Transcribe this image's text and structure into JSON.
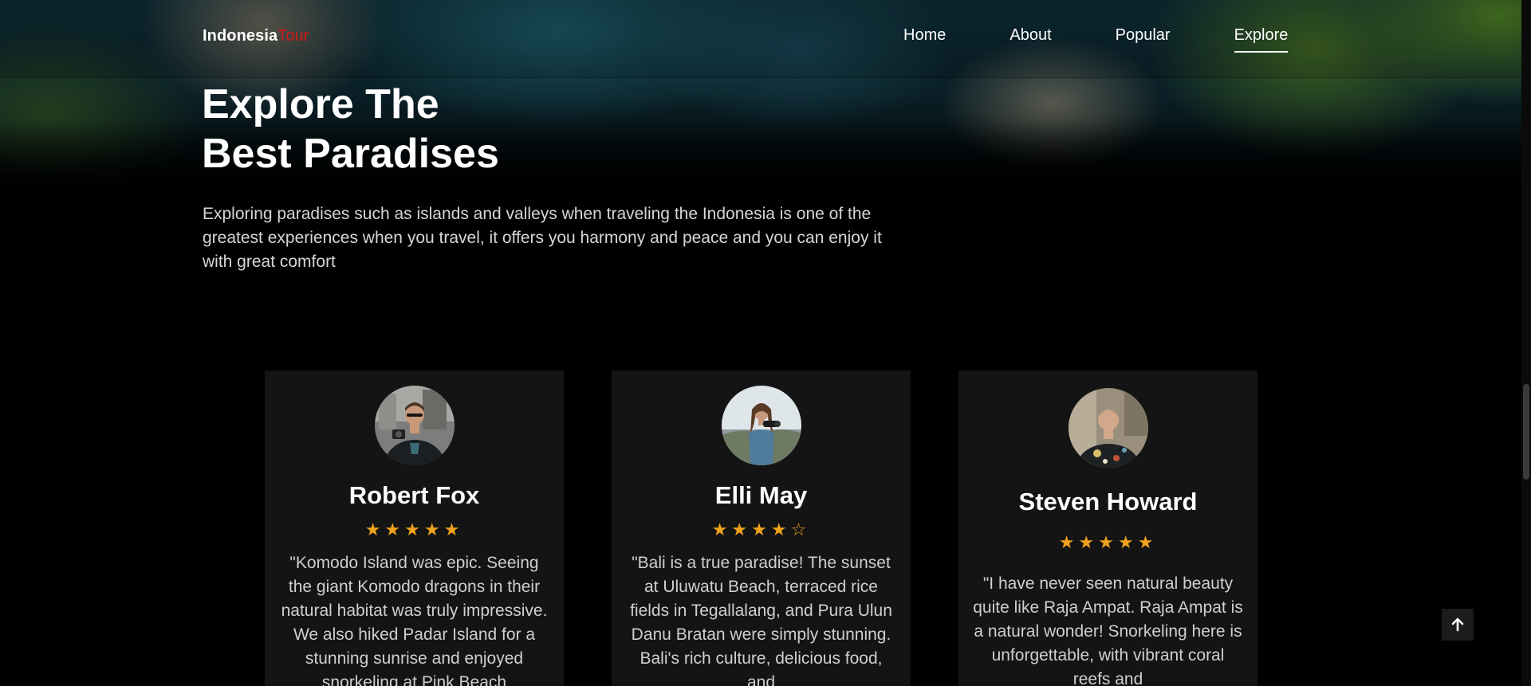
{
  "nav": {
    "logo_main": "Indonesia",
    "logo_accent": "Tour",
    "links": [
      "Home",
      "About",
      "Popular",
      "Explore"
    ],
    "active_link": "Explore"
  },
  "hero": {
    "title_line1": "Explore The",
    "title_line2": "Best Paradises",
    "description": "Exploring paradises such as islands and valleys when traveling the Indonesia is one of the greatest experiences when you travel, it offers you harmony and peace and you can enjoy it with great comfort"
  },
  "testimonials": [
    {
      "name": "Robert Fox",
      "rating": 5,
      "max_rating": 5,
      "stars": "★★★★★",
      "quote": "\"Komodo Island was epic. Seeing the giant Komodo dragons in their natural habitat was truly impressive. We also hiked Padar Island for a stunning sunrise and enjoyed snorkeling at Pink Beach"
    },
    {
      "name": "Elli May",
      "rating": 4,
      "max_rating": 5,
      "stars": "★★★★☆",
      "quote": "\"Bali is a true paradise! The sunset at Uluwatu Beach, terraced rice fields in Tegallalang, and Pura Ulun Danu Bratan were simply stunning. Bali's rich culture, delicious food, and"
    },
    {
      "name": "Steven Howard",
      "rating": 5,
      "max_rating": 5,
      "stars": "★★★★★",
      "quote": "\"I have never seen natural beauty quite like Raja Ampat. Raja Ampat is a natural wonder! Snorkeling here is unforgettable, with vibrant coral reefs and"
    }
  ],
  "back_to_top": {
    "icon": "arrow-up-icon"
  },
  "colors": {
    "accent": "#d11a1a",
    "star": "#f0a31c",
    "card_bg": "#141414",
    "page_bg": "#000000"
  }
}
